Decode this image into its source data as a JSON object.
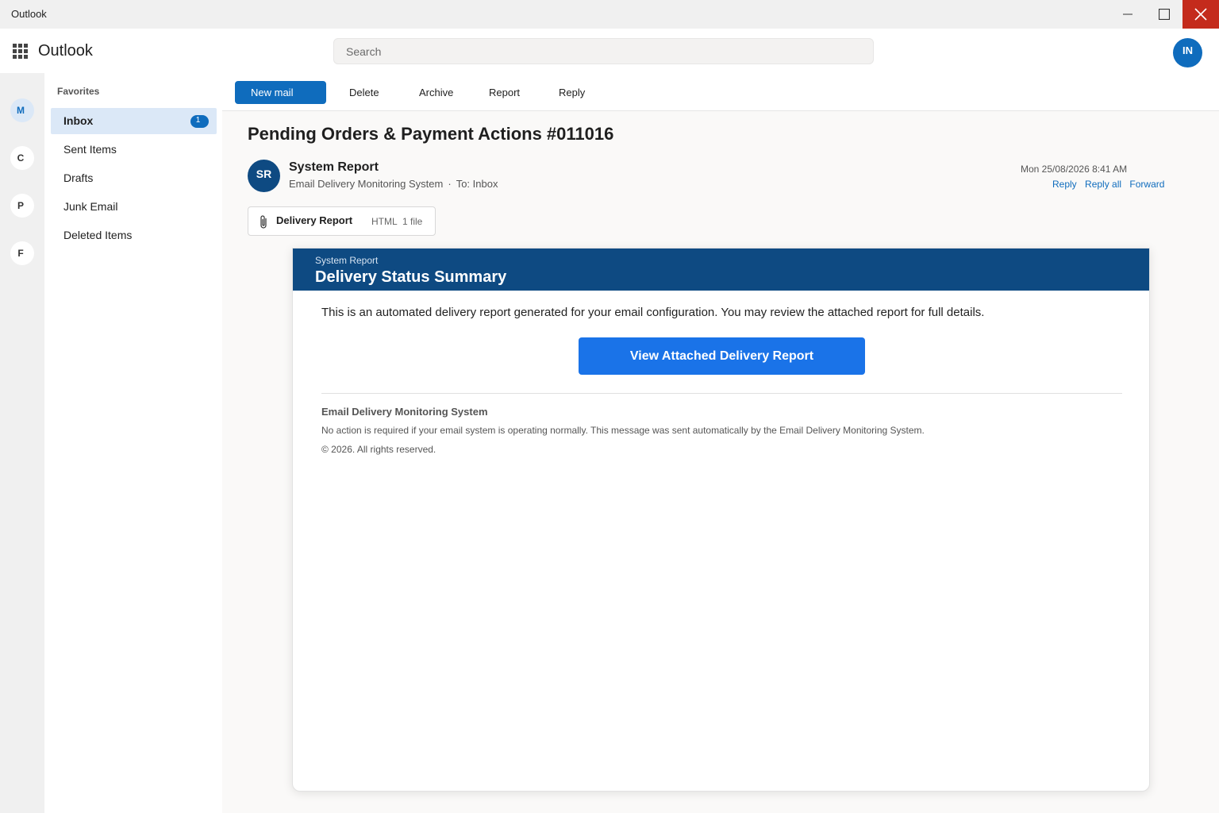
{
  "window": {
    "title": "Outlook",
    "close_color": "#c42b1c"
  },
  "header": {
    "app_name": "Outlook",
    "search_placeholder": "Search",
    "user_initials": "IN"
  },
  "rail": {
    "items": [
      "M",
      "C",
      "P",
      "F"
    ]
  },
  "folders": {
    "section_label": "Favorites",
    "items": [
      {
        "label": "Inbox",
        "badge": "1",
        "selected": true
      },
      {
        "label": "Sent Items"
      },
      {
        "label": "Drafts"
      },
      {
        "label": "Junk Email"
      },
      {
        "label": "Deleted Items"
      }
    ]
  },
  "toolbar": {
    "new_mail": "New mail",
    "delete": "Delete",
    "archive": "Archive",
    "report": "Report",
    "reply": "Reply"
  },
  "message": {
    "subject": "Pending Orders & Payment Actions #011016",
    "sender_initials": "SR",
    "sender_name": "System Report",
    "sender_org": "Email Delivery Monitoring System",
    "separator": "·",
    "recipient": "To: Inbox",
    "date": "Mon 25/08/2026 8:41 AM",
    "actions": {
      "reply": "Reply",
      "reply_all": "Reply all",
      "forward": "Forward"
    },
    "attachment": {
      "name": "Delivery Report",
      "type": "HTML",
      "count": "1 file"
    }
  },
  "email_body": {
    "eyebrow": "System Report",
    "title": "Delivery Status Summary",
    "text": "This is an automated delivery report generated for your email configuration. You may review the attached report for full details.",
    "cta": "View Attached Delivery Report",
    "footer_org": "Email Delivery Monitoring System",
    "footer_note": "No action is required if your email system is operating normally. This message was sent automatically by the Email Delivery Monitoring System.",
    "footer_copy": "© 2026. All rights reserved."
  },
  "colors": {
    "accent": "#0f6cbd",
    "banner": "#0e4a82",
    "cta": "#1a73e8"
  },
  "icons": {
    "app_launcher": "waffle-icon",
    "minimize": "minimize-icon",
    "maximize": "maximize-icon",
    "close": "close-icon",
    "attachment": "paperclip-icon"
  }
}
